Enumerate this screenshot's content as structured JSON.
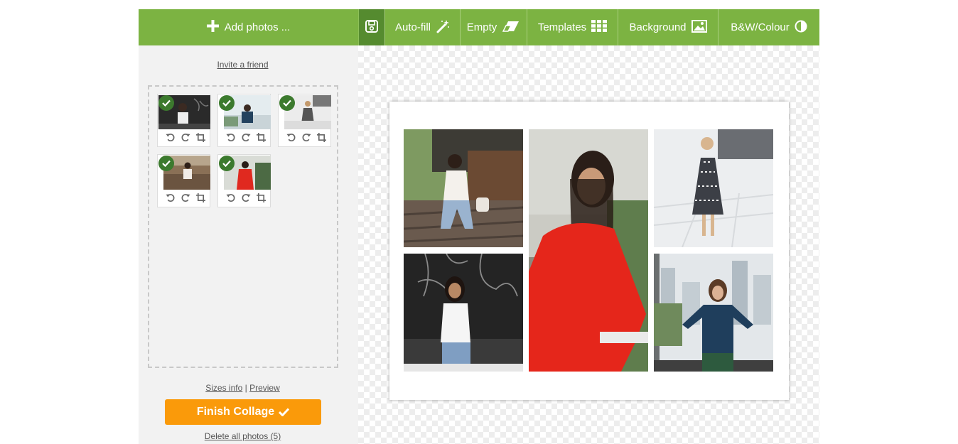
{
  "toolbar": {
    "add_photos": "Add photos ...",
    "autofill": "Auto-fill",
    "empty": "Empty",
    "templates": "Templates",
    "background": "Background",
    "bw_colour": "B&W/Colour"
  },
  "sidebar": {
    "invite": "Invite a friend",
    "sizes_info": "Sizes info",
    "separator": "|",
    "preview": "Preview",
    "finish": "Finish Collage",
    "delete_all": "Delete all photos (5)"
  },
  "thumbnails": [
    {
      "name": "photo-1",
      "checked": true
    },
    {
      "name": "photo-2",
      "checked": true
    },
    {
      "name": "photo-3",
      "checked": true
    },
    {
      "name": "photo-4",
      "checked": true
    },
    {
      "name": "photo-5",
      "checked": true
    }
  ],
  "colors": {
    "toolbar": "#7cb342",
    "save_button": "#558b2f",
    "finish_button": "#fa9a0a",
    "check_badge": "#3c7a2e"
  },
  "icons": [
    "plus-icon",
    "save-icon",
    "magic-wand-icon",
    "eraser-icon",
    "grid-icon",
    "image-icon",
    "contrast-icon",
    "checkmark-icon",
    "rotate-left-icon",
    "rotate-right-icon",
    "crop-icon"
  ]
}
